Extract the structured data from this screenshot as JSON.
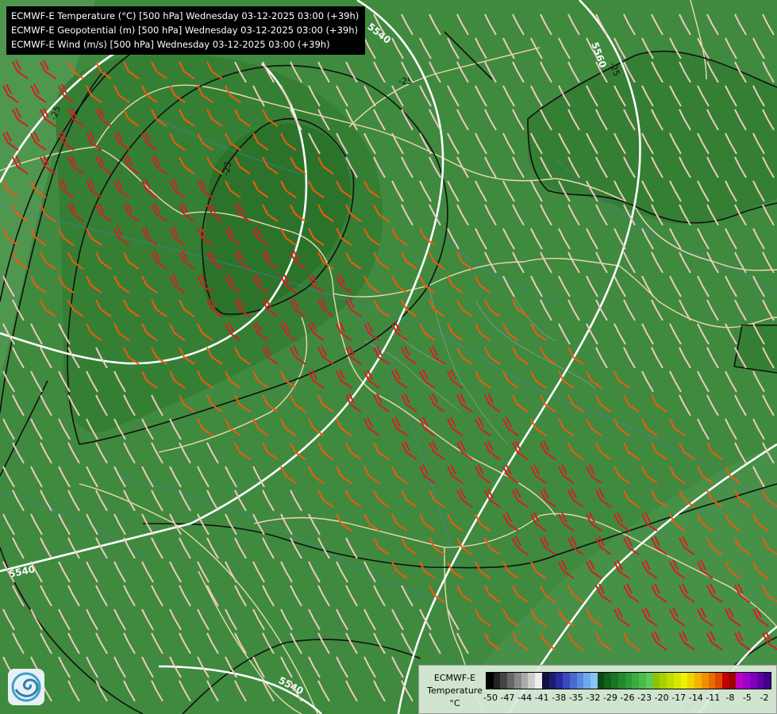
{
  "title": {
    "lines": [
      "ECMWF-E Temperature (°C) [500 hPa] Wednesday 03-12-2025 03:00 (+39h)",
      "ECMWF-E Geopotential (m) [500 hPa] Wednesday 03-12-2025 03:00 (+39h)",
      "ECMWF-E Wind (m/s) [500 hPa] Wednesday 03-12-2025 03:00 (+39h)"
    ]
  },
  "contour_labels": {
    "geopotential": [
      "5540",
      "5560",
      "5540",
      "5540"
    ],
    "temperature": [
      "-25",
      "-23",
      "-25",
      "-25"
    ]
  },
  "legend": {
    "model": "ECMWF-E",
    "variable": "Temperature",
    "unit": "°C",
    "ticks": [
      "-50",
      "-47",
      "-44",
      "-41",
      "-38",
      "-35",
      "-32",
      "-29",
      "-26",
      "-23",
      "-20",
      "-17",
      "-14",
      "-11",
      "-8",
      "-5",
      "-2"
    ],
    "colors": [
      "#000000",
      "#222222",
      "#444444",
      "#666666",
      "#888888",
      "#aaaaaa",
      "#cccccc",
      "#eeeeee",
      "#101040",
      "#1c1c70",
      "#2a2aa0",
      "#3a48c0",
      "#4a6ad0",
      "#5a88e0",
      "#70a8ec",
      "#88c4f2",
      "#0a4a12",
      "#12601a",
      "#1a7422",
      "#22882c",
      "#2e9a36",
      "#3aac42",
      "#4abc4c",
      "#5ccc58",
      "#90c400",
      "#a8d000",
      "#c0dc00",
      "#d8e800",
      "#f0f000",
      "#f0d400",
      "#f0b400",
      "#f09000",
      "#e86c00",
      "#e04800",
      "#c00000",
      "#a00000",
      "#c000c0",
      "#a000d0",
      "#8000c0",
      "#6000a0",
      "#40008a"
    ]
  },
  "logo": {
    "icon": "ecmwf-swirl-logo"
  }
}
